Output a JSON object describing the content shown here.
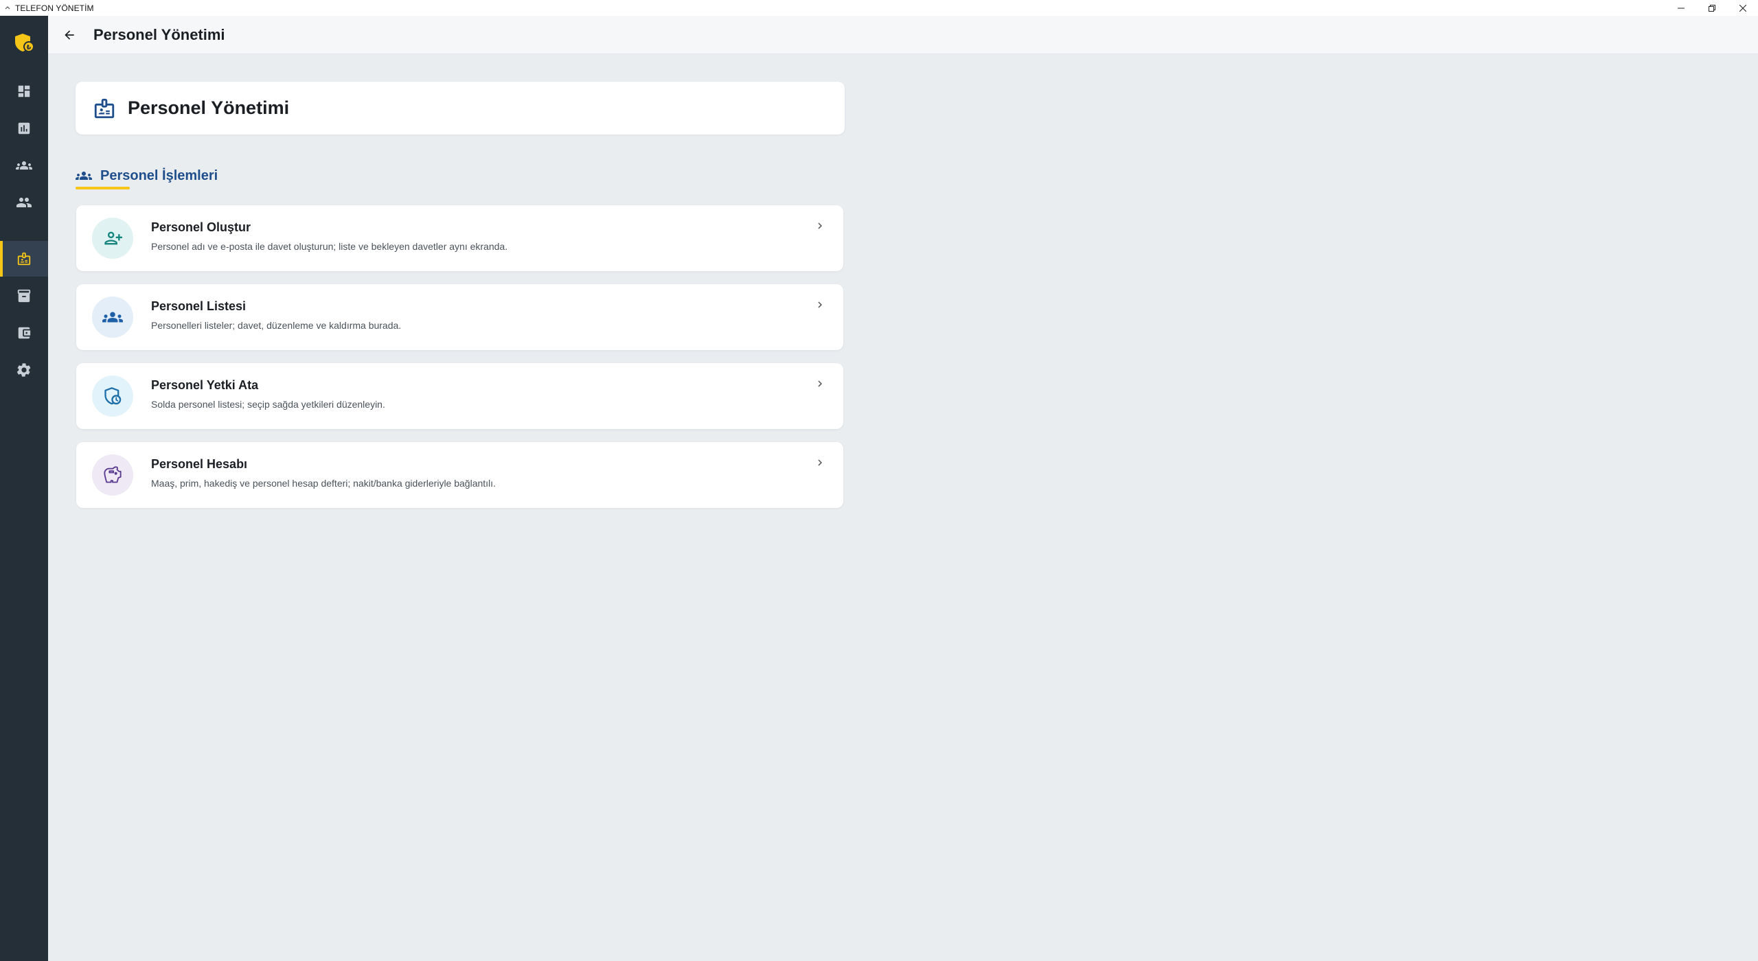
{
  "window": {
    "title": "TELEFON YÖNETİM"
  },
  "header": {
    "title": "Personel Yönetimi"
  },
  "title_card": {
    "title": "Personel Yönetimi"
  },
  "section": {
    "label": "Personel İşlemleri"
  },
  "cards": [
    {
      "title": "Personel Oluştur",
      "description": "Personel adı ve e-posta ile davet oluşturun; liste ve bekleyen davetler aynı ekranda."
    },
    {
      "title": "Personel Listesi",
      "description": "Personelleri listeler; davet, düzenleme ve kaldırma burada."
    },
    {
      "title": "Personel Yetki Ata",
      "description": "Solda personel listesi; seçip sağda yetkileri düzenleyin."
    },
    {
      "title": "Personel Hesabı",
      "description": "Maaş, prim, hakediş ve personel hesap defteri; nakit/banka giderleriyle bağlantılı."
    }
  ],
  "colors": {
    "sidebar_bg": "#252f38",
    "accent_yellow": "#f5c518",
    "primary_blue": "#1f4e8c",
    "page_bg": "#e9edf0"
  }
}
